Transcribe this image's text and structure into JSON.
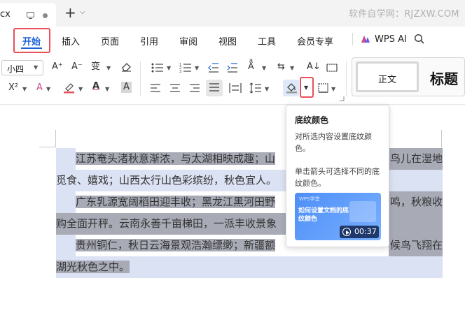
{
  "titlebar": {
    "doc_tab_name": "cx",
    "new_tab_symbol": "+",
    "watermark": "软件自学网：RJZXW.COM"
  },
  "menu": {
    "items": [
      {
        "label": "开始",
        "active": true
      },
      {
        "label": "插入"
      },
      {
        "label": "页面"
      },
      {
        "label": "引用"
      },
      {
        "label": "审阅"
      },
      {
        "label": "视图"
      },
      {
        "label": "工具"
      },
      {
        "label": "会员专享"
      }
    ],
    "wps_ai": "WPS AI",
    "accent_color": "#1a5fd6"
  },
  "toolbar": {
    "font_size": "小四",
    "styles": {
      "normal": "正文",
      "heading": "标题"
    },
    "icons": [
      "font-grow-icon",
      "font-shrink-icon",
      "phonetic-guide-icon",
      "clear-format-icon",
      "superscript-icon",
      "text-effect-icon",
      "highlight-icon",
      "font-color-icon",
      "char-shading-icon",
      "bullet-list-icon",
      "numbered-list-icon",
      "decrease-indent-icon",
      "increase-indent-icon",
      "text-direction-icon",
      "line-break-icon",
      "sort-icon",
      "show-marks-icon",
      "align-left-icon",
      "align-center-icon",
      "align-right-icon",
      "justify-icon",
      "distributed-icon",
      "line-spacing-icon",
      "shading-color-icon",
      "border-icon"
    ],
    "highlight_box_color": "#e8505b"
  },
  "tooltip": {
    "title": "底纹颜色",
    "description": "对所选内容设置底纹颜色。",
    "hint": "单击箭头可选择不同的底纹颜色。",
    "video": {
      "brand": "WPS学堂",
      "caption": "如何设置文档的底纹颜色",
      "duration": "00:37"
    }
  },
  "document": {
    "lines": [
      {
        "text": "江苏奄头渚秋意渐浓，与太湖相映成趣；山",
        "tail": "鸟儿在湿地",
        "indent": true
      },
      {
        "text": "觅食、嬉戏；山西太行山色彩缤纷，秋色宜人。",
        "indent": false
      },
      {
        "text": "广东乳源宽阔稻田迎丰收；黑龙江黑河田野",
        "tail": "鸣，秋粮收",
        "indent": true
      },
      {
        "text": "购全面开秤。云南永善千亩梯田，一派丰收景象",
        "indent": false
      },
      {
        "text": "贵州铜仁，秋日云海景观浩瀚缥缈；新疆额",
        "tail": "候鸟飞翔在",
        "indent": true
      },
      {
        "text": "湖光秋色之中。",
        "indent": false
      }
    ],
    "selection_color": "#a8abb6",
    "selection_light_color": "#dbe2f3"
  }
}
